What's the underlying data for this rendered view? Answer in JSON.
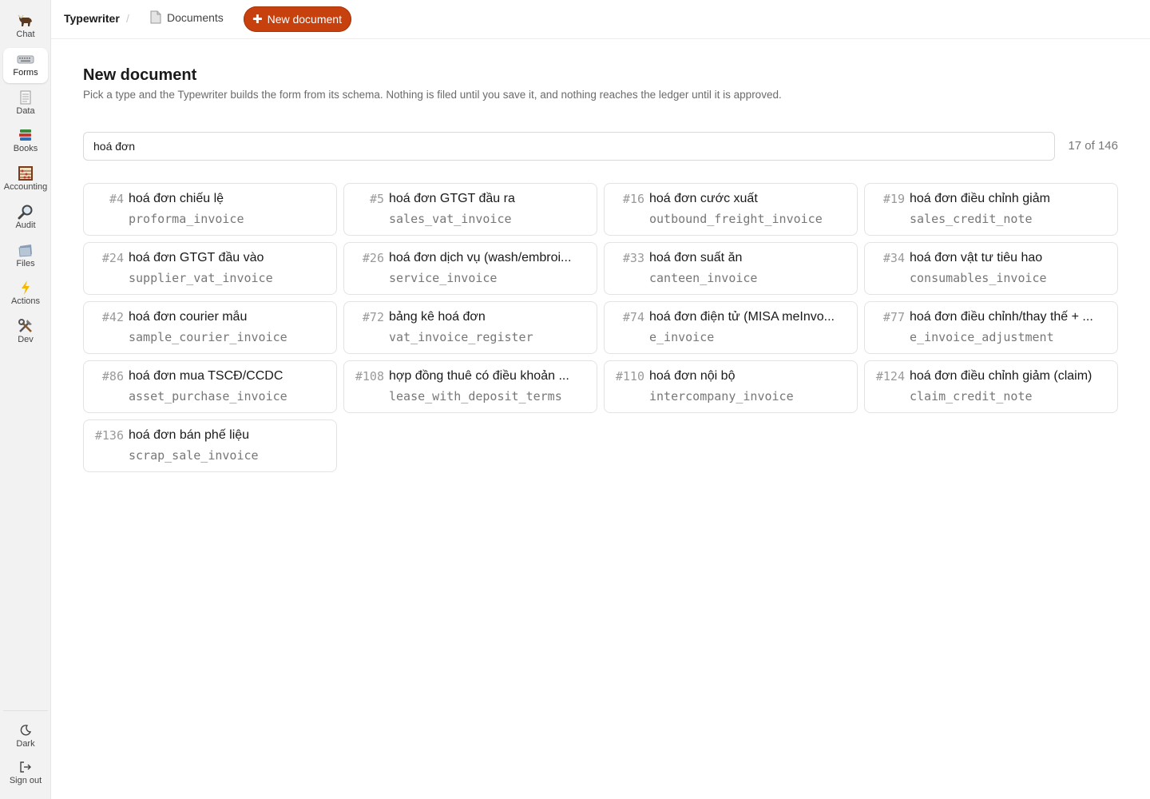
{
  "sidebar": {
    "items": [
      {
        "label": "Chat",
        "icon": "ox-icon"
      },
      {
        "label": "Forms",
        "icon": "keyboard-icon"
      },
      {
        "label": "Data",
        "icon": "ledger-icon"
      },
      {
        "label": "Books",
        "icon": "books-icon"
      },
      {
        "label": "Accounting",
        "icon": "abacus-icon"
      },
      {
        "label": "Audit",
        "icon": "magnifier-icon"
      },
      {
        "label": "Files",
        "icon": "folder-icon"
      },
      {
        "label": "Actions",
        "icon": "lightning-icon"
      },
      {
        "label": "Dev",
        "icon": "tools-icon"
      }
    ],
    "active": "Forms",
    "bottom": [
      {
        "label": "Dark",
        "icon": "moon-icon"
      },
      {
        "label": "Sign out",
        "icon": "sign-out-icon"
      }
    ]
  },
  "topbar": {
    "app_title": "Typewriter",
    "separator": "/",
    "breadcrumb_documents": "Documents",
    "new_button_label": "New document",
    "accent_color": "#c7410f"
  },
  "main": {
    "title": "New document",
    "subtitle": "Pick a type and the Typewriter builds the form from its schema. Nothing is filed until you save it, and nothing reaches the ledger until it is approved.",
    "search_value": "hoá đơn",
    "count": "17 of 146",
    "results": [
      {
        "num": "#4",
        "title": "hoá đơn chiếu lệ",
        "key": "proforma_invoice"
      },
      {
        "num": "#5",
        "title": "hoá đơn GTGT đầu ra",
        "key": "sales_vat_invoice"
      },
      {
        "num": "#16",
        "title": "hoá đơn cước xuất",
        "key": "outbound_freight_invoice"
      },
      {
        "num": "#19",
        "title": "hoá đơn điều chỉnh giảm",
        "key": "sales_credit_note"
      },
      {
        "num": "#24",
        "title": "hoá đơn GTGT đầu vào",
        "key": "supplier_vat_invoice"
      },
      {
        "num": "#26",
        "title": "hoá đơn dịch vụ (wash/embroi...",
        "key": "service_invoice"
      },
      {
        "num": "#33",
        "title": "hoá đơn suất ăn",
        "key": "canteen_invoice"
      },
      {
        "num": "#34",
        "title": "hoá đơn vật tư tiêu hao",
        "key": "consumables_invoice"
      },
      {
        "num": "#42",
        "title": "hoá đơn courier mẫu",
        "key": "sample_courier_invoice"
      },
      {
        "num": "#72",
        "title": "bảng kê hoá đơn",
        "key": "vat_invoice_register"
      },
      {
        "num": "#74",
        "title": "hoá đơn điện tử (MISA meInvo...",
        "key": "e_invoice"
      },
      {
        "num": "#77",
        "title": "hoá đơn điều chỉnh/thay thế + ...",
        "key": "e_invoice_adjustment"
      },
      {
        "num": "#86",
        "title": "hoá đơn mua TSCĐ/CCDC",
        "key": "asset_purchase_invoice"
      },
      {
        "num": "#108",
        "title": "hợp đồng thuê có điều khoản ...",
        "key": "lease_with_deposit_terms"
      },
      {
        "num": "#110",
        "title": "hoá đơn nội bộ",
        "key": "intercompany_invoice"
      },
      {
        "num": "#124",
        "title": "hoá đơn điều chỉnh giảm (claim)",
        "key": "claim_credit_note"
      },
      {
        "num": "#136",
        "title": "hoá đơn bán phế liệu",
        "key": "scrap_sale_invoice"
      }
    ]
  }
}
